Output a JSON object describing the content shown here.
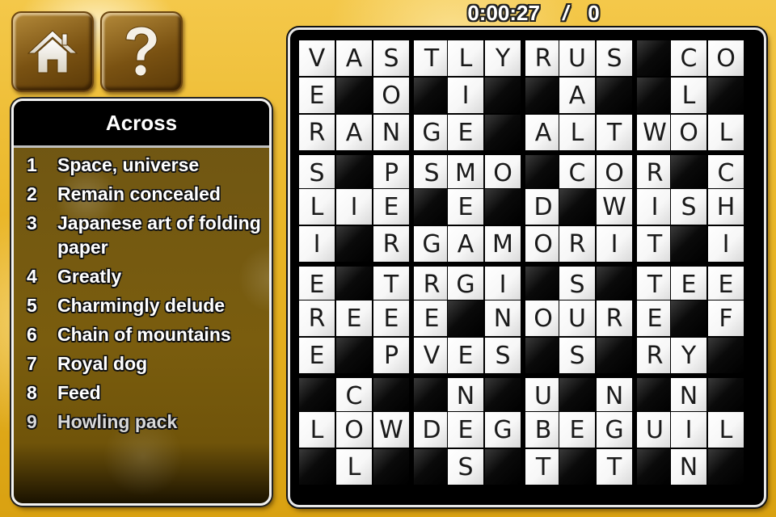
{
  "status": {
    "timer": "0:00:27",
    "separator": "/",
    "score": "0"
  },
  "toolbar": {
    "home_icon": "home-icon",
    "help_icon": "question-mark-icon"
  },
  "clues": {
    "heading": "Across",
    "items": [
      {
        "num": "1",
        "text": "Space, universe"
      },
      {
        "num": "2",
        "text": "Remain concealed"
      },
      {
        "num": "3",
        "text": "Japanese art of folding paper"
      },
      {
        "num": "4",
        "text": "Greatly"
      },
      {
        "num": "5",
        "text": "Charmingly delude"
      },
      {
        "num": "6",
        "text": "Chain of mountains"
      },
      {
        "num": "7",
        "text": "Royal dog"
      },
      {
        "num": "8",
        "text": "Feed"
      },
      {
        "num": "9",
        "text": "Howling pack"
      }
    ]
  },
  "grid": {
    "rows": [
      "VASTLYRUS#CO",
      "E#O#I##A##L#",
      "RANGE#ALTWOL",
      "S#PSMO#COR#C",
      "LIE#E#D#WISH",
      "I#RGAMORIT#I",
      "E#TRGI#S#TEE",
      "REEE#NOURE#F",
      "E#PVES#S#RY#",
      "#C##N#U#N#N#",
      "LOWDEGBEGUIL",
      "#L##S#T#T#N#"
    ]
  }
}
